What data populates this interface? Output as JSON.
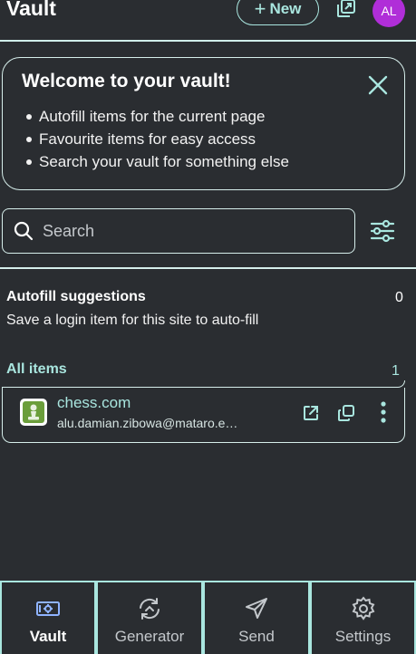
{
  "header": {
    "title": "Vault",
    "new_label": "New",
    "avatar_initials": "AL",
    "avatar_color": "#b02ed8"
  },
  "welcome": {
    "title": "Welcome to your vault!",
    "bullets": [
      "Autofill items for the current page",
      "Favourite items for easy access",
      "Search your vault for something else"
    ]
  },
  "search": {
    "placeholder": "Search",
    "value": ""
  },
  "autofill": {
    "title": "Autofill suggestions",
    "count": "0",
    "description": "Save a login item for this site to auto-fill"
  },
  "all_items": {
    "title": "All items",
    "count": "1",
    "items": [
      {
        "name": "chess.com",
        "username": "alu.damian.zibowa@mataro.e…",
        "icon": "chess-pawn-icon"
      }
    ]
  },
  "nav": {
    "vault": "Vault",
    "generator": "Generator",
    "send": "Send",
    "settings": "Settings"
  },
  "colors": {
    "background": "#2a2d31",
    "accent": "#a9e6df",
    "active_nav_icon": "#8fb3ff"
  }
}
